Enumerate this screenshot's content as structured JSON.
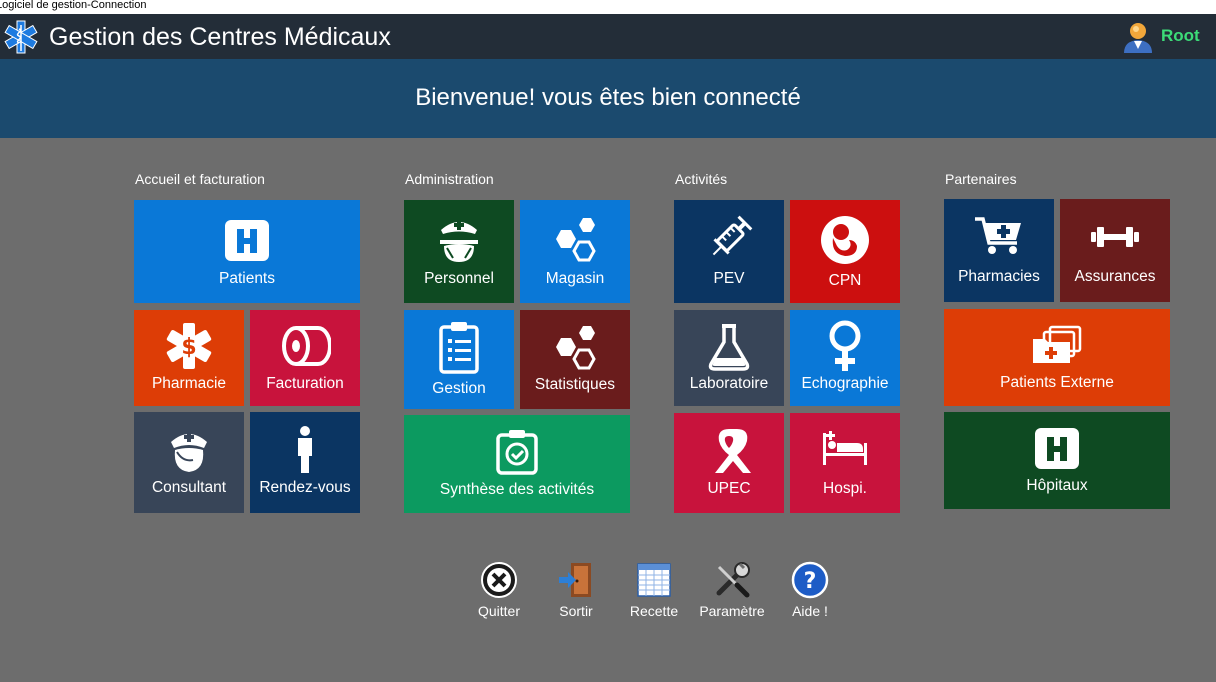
{
  "window": {
    "title": "Logiciel de gestion-Connection"
  },
  "header": {
    "title": "Gestion des Centres Médicaux",
    "user": "Root"
  },
  "banner": {
    "message": "Bienvenue! vous êtes bien connecté"
  },
  "sections": {
    "accueil": {
      "label": "Accueil et facturation",
      "tiles": {
        "patients": "Patients",
        "pharmacie": "Pharmacie",
        "facturation": "Facturation",
        "consultant": "Consultant",
        "rendezvous": "Rendez-vous"
      }
    },
    "administration": {
      "label": "Administration",
      "tiles": {
        "personnel": "Personnel",
        "magasin": "Magasin",
        "gestion": "Gestion",
        "statistiques": "Statistiques",
        "synthese": "Synthèse des activités"
      }
    },
    "activites": {
      "label": "Activités",
      "tiles": {
        "pev": "PEV",
        "cpn": "CPN",
        "laboratoire": "Laboratoire",
        "echographie": "Echographie",
        "upec": "UPEC",
        "hospi": "Hospi."
      }
    },
    "partenaires": {
      "label": "Partenaires",
      "tiles": {
        "pharmacies": "Pharmacies",
        "assurances": "Assurances",
        "patients_externe": "Patients Externe",
        "hopitaux": "Hôpitaux"
      }
    }
  },
  "toolbar": {
    "quitter": "Quitter",
    "sortir": "Sortir",
    "recette": "Recette",
    "parametre": "Paramètre",
    "aide": "Aide !"
  },
  "colors": {
    "blue": "#0a78d7",
    "orange": "#dd3d06",
    "crimson": "#c8133c",
    "slate": "#384558",
    "navy": "#0b3562",
    "darkgreen": "#0e4a22",
    "maroon": "#6a1c1c",
    "green": "#0c9a60",
    "red": "#cc0f0f",
    "header": "#232d38",
    "banner": "#1b4a6e",
    "user": "#3cdc78"
  },
  "icons": {
    "app": "star-of-life-icon",
    "user": "user-avatar-icon",
    "patients": "hospital-h-icon",
    "pharmacie": "medical-star-icon",
    "facturation": "paper-roll-icon",
    "consultant": "nurse-head-icon",
    "rendezvous": "person-icon",
    "personnel": "nurse-icon",
    "magasin": "hexagons-icon",
    "gestion": "clipboard-list-icon",
    "statistiques": "hexagons-icon",
    "synthese": "clipboard-check-icon",
    "pev": "syringe-icon",
    "cpn": "fetus-icon",
    "laboratoire": "flask-icon",
    "echographie": "female-symbol-icon",
    "upec": "awareness-ribbon-icon",
    "hospi": "hospital-bed-icon",
    "pharmacies": "cart-plus-icon",
    "assurances": "dumbbell-icon",
    "patients_externe": "medical-folders-icon",
    "hopitaux": "hospital-h-icon",
    "quitter": "close-circle-icon",
    "sortir": "door-exit-icon",
    "recette": "spreadsheet-icon",
    "parametre": "tools-icon",
    "aide": "help-icon"
  }
}
